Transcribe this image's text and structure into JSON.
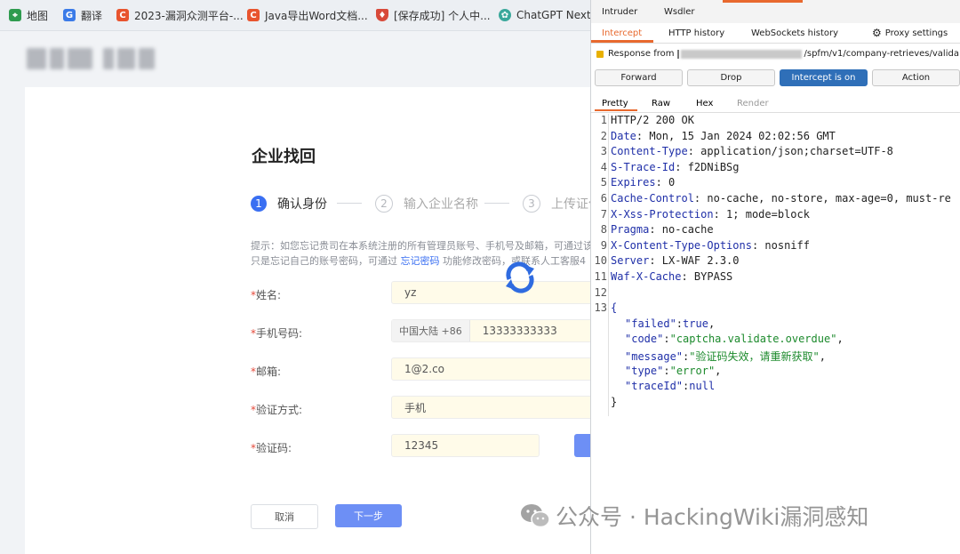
{
  "bookmarks": [
    {
      "label": "地图",
      "icon": "map-pin-icon",
      "color": "#2e9b4f"
    },
    {
      "label": "翻译",
      "icon": "translate-icon",
      "color": "#3b7be8"
    },
    {
      "label": "2023-漏洞众测平台-...",
      "icon": "csdn-c-icon",
      "color": "#e8542e"
    },
    {
      "label": "Java导出Word文档...",
      "icon": "csdn-c-icon",
      "color": "#e8542e"
    },
    {
      "label": "[保存成功] 个人中...",
      "icon": "shield-icon",
      "color": "#d84a3a"
    },
    {
      "label": "ChatGPT Next V",
      "icon": "chatgpt-icon",
      "color": "#3aa89b"
    }
  ],
  "form": {
    "title": "企业找回",
    "steps": [
      {
        "num": "1",
        "label": "确认身份"
      },
      {
        "num": "2",
        "label": "输入企业名称"
      },
      {
        "num": "3",
        "label": "上传证件"
      }
    ],
    "hint_line1": "提示：如您忘记贵司在本系统注册的所有管理员账号、手机号及邮箱，可通过该",
    "hint_line2_pre": "只是忘记自己的账号密码，可通过 ",
    "hint_link": "忘记密码",
    "hint_line2_post": " 功能修改密码，或联系人工客服4",
    "fields": {
      "name": {
        "label": "姓名:",
        "value": "yz"
      },
      "phone": {
        "label": "手机号码:",
        "prefix": "中国大陆 +86",
        "value": "13333333333"
      },
      "email": {
        "label": "邮箱:",
        "value": "1@2.co"
      },
      "method": {
        "label": "验证方式:",
        "value": "手机"
      },
      "code": {
        "label": "验证码:",
        "value": "12345"
      }
    },
    "required_mark": "*",
    "cancel": "取消",
    "next": "下一步"
  },
  "burp": {
    "tabs_top": [
      "Intruder",
      "Wsdler"
    ],
    "tabs_proxy": [
      "Intercept",
      "HTTP history",
      "WebSockets history"
    ],
    "proxy_settings": "Proxy settings",
    "response_from": "Response from",
    "response_url": "/spfm/v1/company-retrieves/valida",
    "buttons": [
      "Forward",
      "Drop",
      "Intercept is on",
      "Action"
    ],
    "view_tabs": [
      "Pretty",
      "Raw",
      "Hex",
      "Render"
    ],
    "lines": [
      {
        "n": "1",
        "k": "HTTP/2 200 OK",
        "v": ""
      },
      {
        "n": "2",
        "k": "Date",
        "v": ": Mon, 15 Jan 2024 02:02:56 GMT"
      },
      {
        "n": "3",
        "k": "Content-Type",
        "v": ": application/json;charset=UTF-8"
      },
      {
        "n": "4",
        "k": "S-Trace-Id",
        "v": ": f2DNiBSg"
      },
      {
        "n": "5",
        "k": "Expires",
        "v": ": 0"
      },
      {
        "n": "6",
        "k": "Cache-Control",
        "v": ": no-cache, no-store, max-age=0, must-re"
      },
      {
        "n": "7",
        "k": "X-Xss-Protection",
        "v": ": 1; mode=block"
      },
      {
        "n": "8",
        "k": "Pragma",
        "v": ": no-cache"
      },
      {
        "n": "9",
        "k": "X-Content-Type-Options",
        "v": ": nosniff"
      },
      {
        "n": "10",
        "k": "Server",
        "v": ": LX-WAF 2.3.0"
      },
      {
        "n": "11",
        "k": "Waf-X-Cache",
        "v": ": BYPASS"
      },
      {
        "n": "12",
        "k": "",
        "v": ""
      },
      {
        "n": "13",
        "k": "{",
        "v": ""
      }
    ],
    "json_lines": [
      {
        "k": "\"failed\"",
        "v": "true",
        "tail": ","
      },
      {
        "k": "\"code\"",
        "v": "\"captcha.validate.overdue\"",
        "tail": ","
      },
      {
        "k": "\"message\"",
        "v": "\"验证码失效，请重新获取\"",
        "tail": ","
      },
      {
        "k": "\"type\"",
        "v": "\"error\"",
        "tail": ","
      },
      {
        "k": "\"traceId\"",
        "v": "null",
        "tail": ""
      }
    ],
    "close_brace": "}"
  },
  "watermark": "公众号 · HackingWiki漏洞感知"
}
